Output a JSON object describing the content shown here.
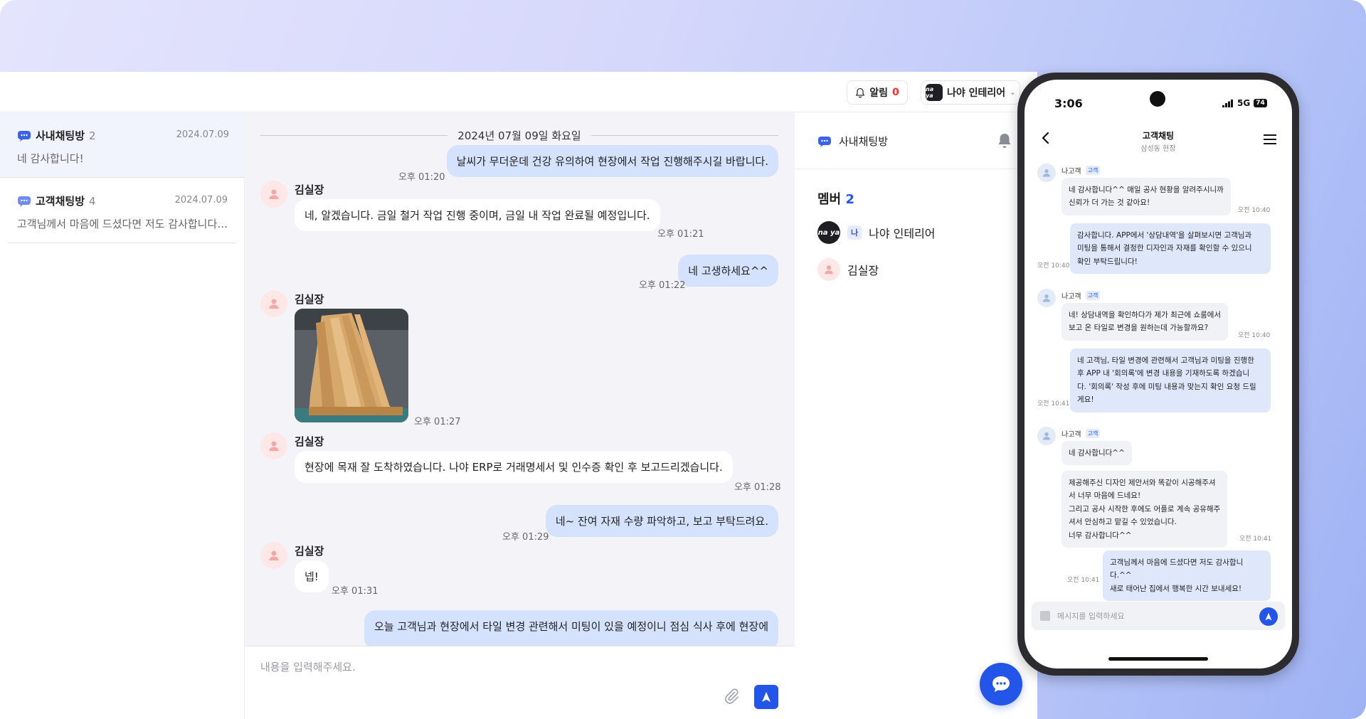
{
  "topbar": {
    "notification_label": "알림",
    "notification_count": "0",
    "company_logo": "na ya",
    "company_name": "나야 인테리어"
  },
  "rooms": [
    {
      "name": "사내채팅방",
      "count": "2",
      "date": "2024.07.09",
      "preview": "네 감사합니다!",
      "active": true
    },
    {
      "name": "고객채팅방",
      "count": "4",
      "date": "2024.07.09",
      "preview": "고객님께서 마음에 드셨다면 저도 감사합니다....",
      "active": false
    }
  ],
  "chat": {
    "date_separator": "2024년 07월 09일 화요일",
    "messages": [
      {
        "type": "out",
        "text": "날씨가 무더운데 건강 유의하여 현장에서 작업 진행해주시길 바랍니다.",
        "time": "오후 01:20"
      },
      {
        "type": "in",
        "sender": "김실장",
        "text": "네, 알겠습니다. 금일 철거 작업 진행 중이며, 금일 내 작업 완료될 예정입니다.",
        "time": "오후 01:21"
      },
      {
        "type": "out",
        "text": "네 고생하세요^^",
        "time": "오후 01:22"
      },
      {
        "type": "in-image",
        "sender": "김실장",
        "time": "오후 01:27"
      },
      {
        "type": "in",
        "sender": "김실장",
        "text": "현장에 목재 잘 도착하였습니다. 나야 ERP로 거래명세서 및 인수증 확인 후 보고드리겠습니다.",
        "time": "오후 01:28"
      },
      {
        "type": "out",
        "text": "네~ 잔여 자재 수량 파악하고, 보고 부탁드려요.",
        "time": "오후 01:29"
      },
      {
        "type": "in",
        "sender": "김실장",
        "text": "넵!",
        "time": "오후 01:31"
      },
      {
        "type": "out",
        "text": "오늘 고객님과 현장에서 타일 변경 관련해서 미팅이 있을 예정이니 점심 식사 후에 현장에"
      }
    ],
    "composer_placeholder": "내용을 입력해주세요."
  },
  "info": {
    "room_title": "사내채팅방",
    "members_label": "멤버",
    "members_count": "2",
    "members": [
      {
        "name": "나야 인테리어",
        "logo": "na ya",
        "tag": "나"
      },
      {
        "name": "김실장"
      }
    ]
  },
  "phone": {
    "clock": "3:06",
    "network": "5G",
    "battery": "74",
    "title": "고객채팅",
    "subtitle": "삼성동 현장",
    "messages": [
      {
        "type": "in",
        "sender": "나고객",
        "tag": "고객",
        "lines": [
          "네 감사합니다^^ 매일 공사 현황을 알려주시니까",
          "신뢰가 더 가는 것 같아요!"
        ],
        "time": "오전 10:40"
      },
      {
        "type": "out",
        "lines": [
          "감사합니다. APP에서 '상담내역'을 살펴보시면 고객님과",
          "미팅을 통해서 결정한 디자인과 자재를 확인할 수 있으니",
          "확인 부탁드립니다!"
        ],
        "time": "오전 10:40"
      },
      {
        "type": "in",
        "sender": "나고객",
        "tag": "고객",
        "lines": [
          "네! 상담내역을 확인하다가 제가 최근에 쇼룸에서",
          "보고 온 타일로 변경을 원하는데 가능할까요?"
        ],
        "time": "오전 10:40"
      },
      {
        "type": "out",
        "lines": [
          "네 고객님, 타일 변경에 관련해서 고객님과 미팅을 진행한",
          "후 APP 내 '회의록'에 변경 내용을 기재하도록 하겠습니",
          "다. '회의록' 작성 후에 미팅 내용과 맞는지 확인 요청 드릴",
          "게요!"
        ],
        "time": "오전 10:41"
      },
      {
        "type": "in",
        "sender": "나고객",
        "tag": "고객",
        "lines": [
          "네 감사합니다^^"
        ]
      },
      {
        "type": "in-cont",
        "lines": [
          "제공해주신 디자인 제안서와 똑같이 시공해주셔",
          "서 너무 마음에 드네요!",
          "그리고 공사 시작한 후에도 어플로 계속 공유해주",
          "셔서 안심하고 맡길 수 있었습니다.",
          "너무 감사합니다^^"
        ],
        "time": "오전 10:41"
      },
      {
        "type": "out",
        "lines": [
          "고객님께서 마음에 드셨다면 저도 감사합니다.^^",
          "새로 태어난 집에서 행복한 시간 보내세요!"
        ],
        "time": "오전 10:41"
      }
    ],
    "input_placeholder": "메시지를 입력하세요"
  },
  "colors": {
    "accent": "#2355e8",
    "out_bubble": "#d4e2fd",
    "alert_red": "#ff2a2a"
  }
}
